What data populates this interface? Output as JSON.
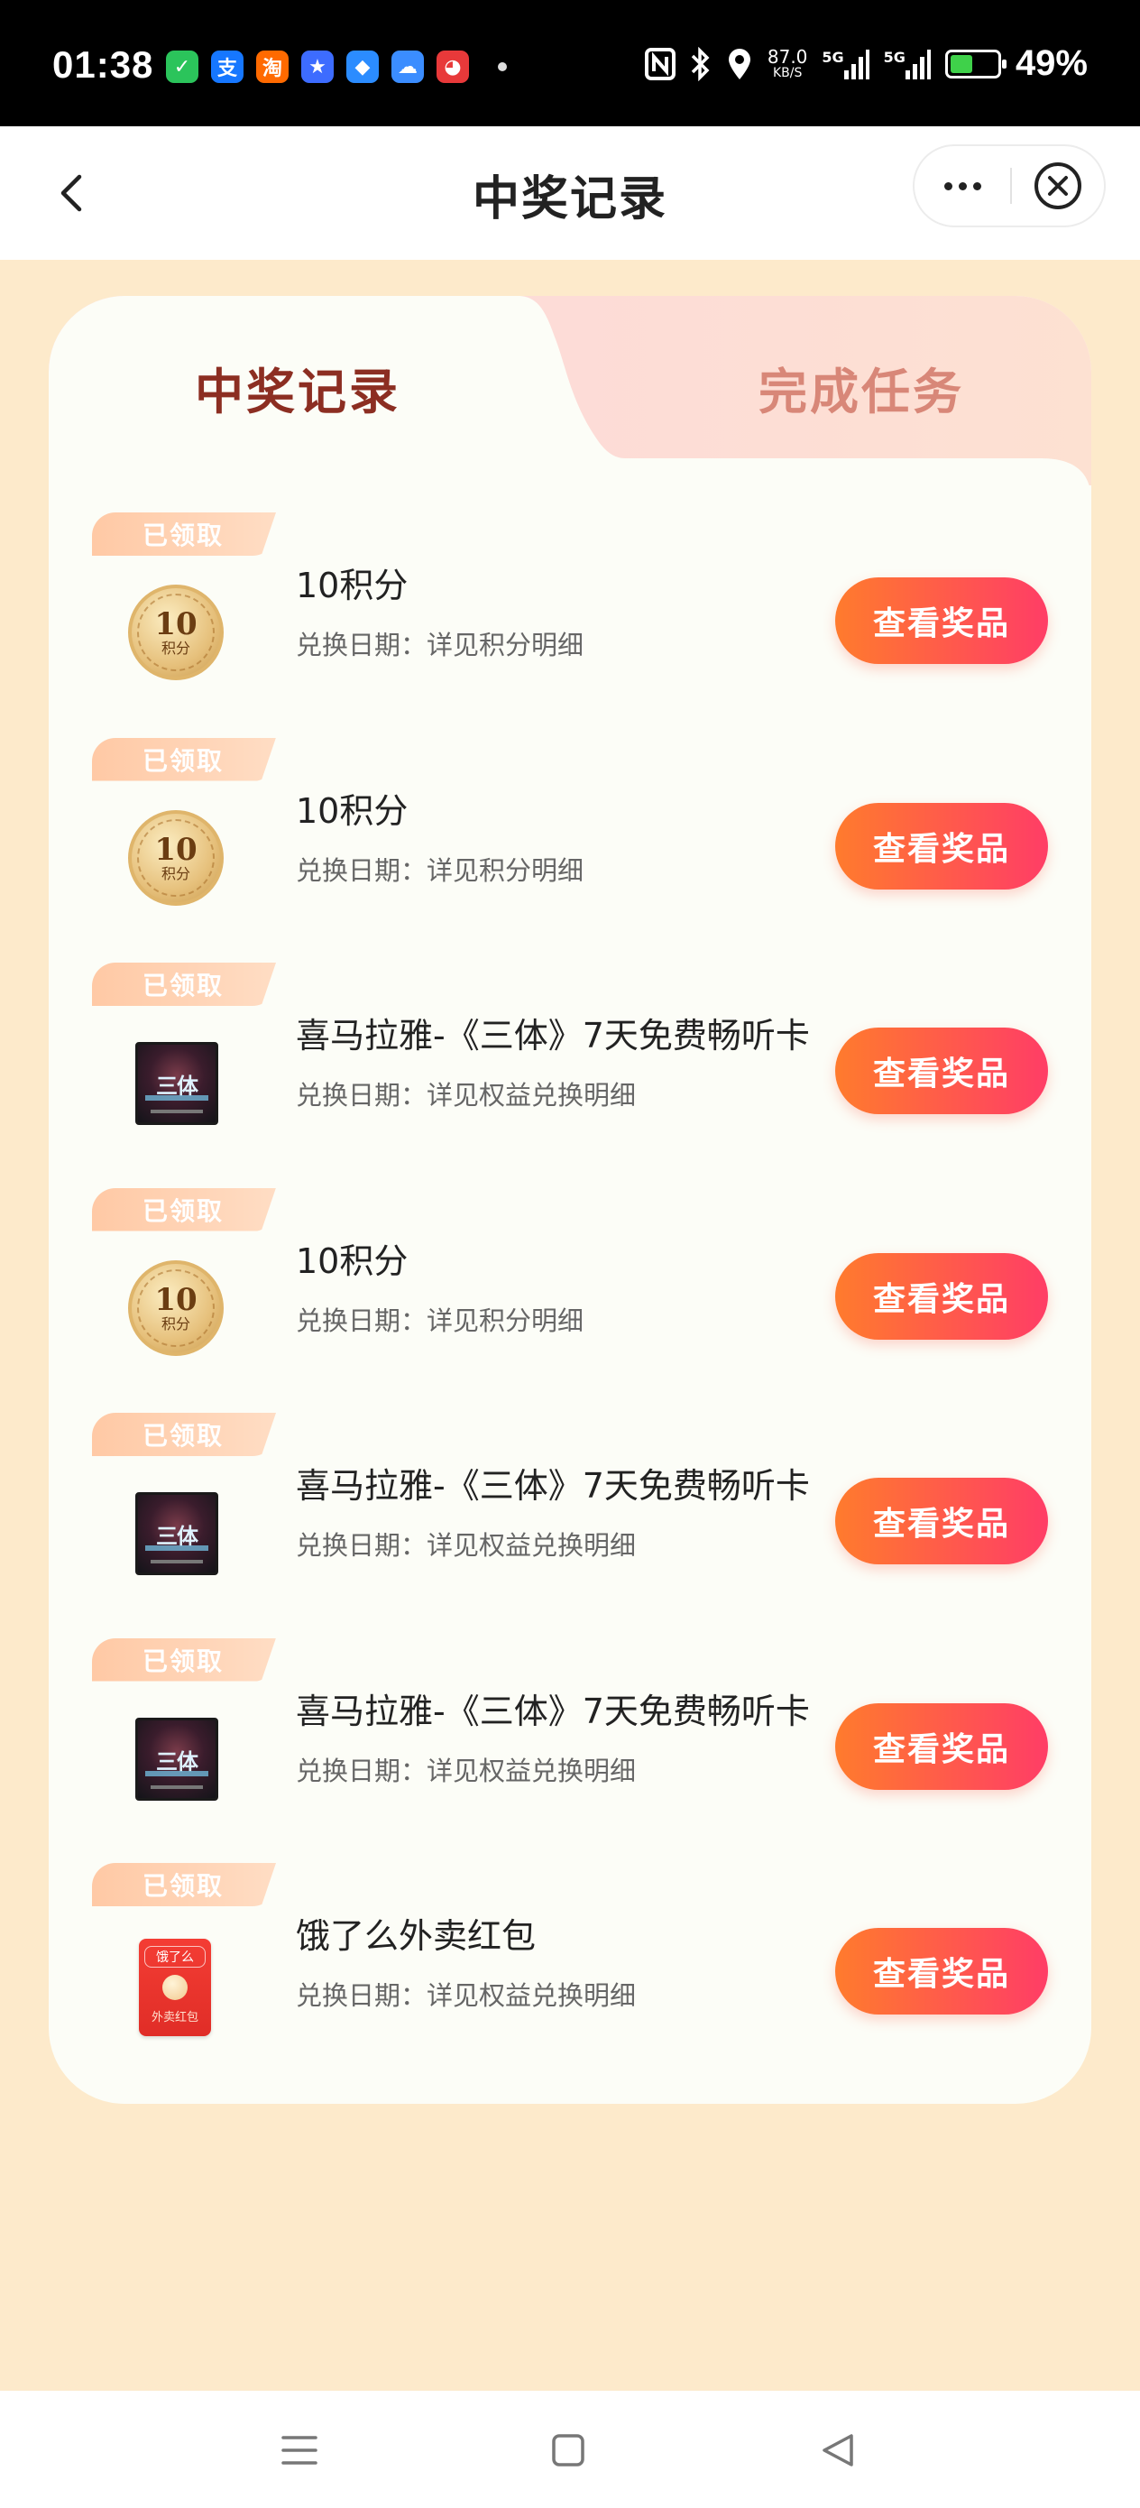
{
  "status_bar": {
    "time": "01:38",
    "apps": [
      {
        "icon": "wechat-icon",
        "glyph": "✓",
        "color": "#2bc45b"
      },
      {
        "icon": "alipay-icon",
        "glyph": "支",
        "color": "#1677ff"
      },
      {
        "icon": "taobao-icon",
        "glyph": "淘",
        "color": "#ff6a00"
      },
      {
        "icon": "star-app-icon",
        "glyph": "★",
        "color": "#3d6cff"
      },
      {
        "icon": "blue-app-icon",
        "glyph": "◆",
        "color": "#2b8cff"
      },
      {
        "icon": "cloud-app-icon",
        "glyph": "☁",
        "color": "#3b8dff"
      },
      {
        "icon": "red-app-icon",
        "glyph": "◕",
        "color": "#e8393a"
      }
    ],
    "net_speed": "87.0",
    "net_unit": "KB/S",
    "signal_1": "5G",
    "signal_2": "5G",
    "battery_pct": "49%",
    "battery_level": 0.49,
    "battery_color": "#3fd14a"
  },
  "header": {
    "title": "中奖记录",
    "back_icon": "back-arrow-icon",
    "more_icon": "more-dots-icon",
    "close_icon": "close-circle-icon"
  },
  "tabs": [
    {
      "label": "中奖记录",
      "active": true
    },
    {
      "label": "完成任务",
      "active": false
    }
  ],
  "records": [
    {
      "badge": "已领取",
      "thumb": "coin",
      "coin_value": "10",
      "coin_sub": "积分",
      "title": "10积分",
      "date": "兑换日期：详见积分明细",
      "button": "查看奖品"
    },
    {
      "badge": "已领取",
      "thumb": "coin",
      "coin_value": "10",
      "coin_sub": "积分",
      "title": "10积分",
      "date": "兑换日期：详见积分明细",
      "button": "查看奖品"
    },
    {
      "badge": "已领取",
      "thumb": "cover",
      "cover_text": "三体",
      "title": "喜马拉雅-《三体》7天免费畅听卡",
      "date": "兑换日期：详见权益兑换明细",
      "button": "查看奖品"
    },
    {
      "badge": "已领取",
      "thumb": "coin",
      "coin_value": "10",
      "coin_sub": "积分",
      "title": "10积分",
      "date": "兑换日期：详见积分明细",
      "button": "查看奖品"
    },
    {
      "badge": "已领取",
      "thumb": "cover",
      "cover_text": "三体",
      "title": "喜马拉雅-《三体》7天免费畅听卡",
      "date": "兑换日期：详见权益兑换明细",
      "button": "查看奖品"
    },
    {
      "badge": "已领取",
      "thumb": "cover",
      "cover_text": "三体",
      "title": "喜马拉雅-《三体》7天免费畅听卡",
      "date": "兑换日期：详见权益兑换明细",
      "button": "查看奖品"
    },
    {
      "badge": "已领取",
      "thumb": "redpacket",
      "rp_brand": "饿了么",
      "rp_text": "外卖红包",
      "title": "饿了么外卖红包",
      "date": "兑换日期：详见权益兑换明细",
      "button": "查看奖品"
    }
  ],
  "nav_bar": {
    "menu_icon": "menu-lines-icon",
    "home_icon": "home-square-icon",
    "back_icon": "back-triangle-icon"
  },
  "colors": {
    "page_bg": "#fdeacb",
    "active_tab": "#8c2e22",
    "inactive_tab": "#d88778",
    "button_start": "#ff7b2d",
    "button_end": "#ff3d66",
    "badge": "#ffc9a5"
  }
}
